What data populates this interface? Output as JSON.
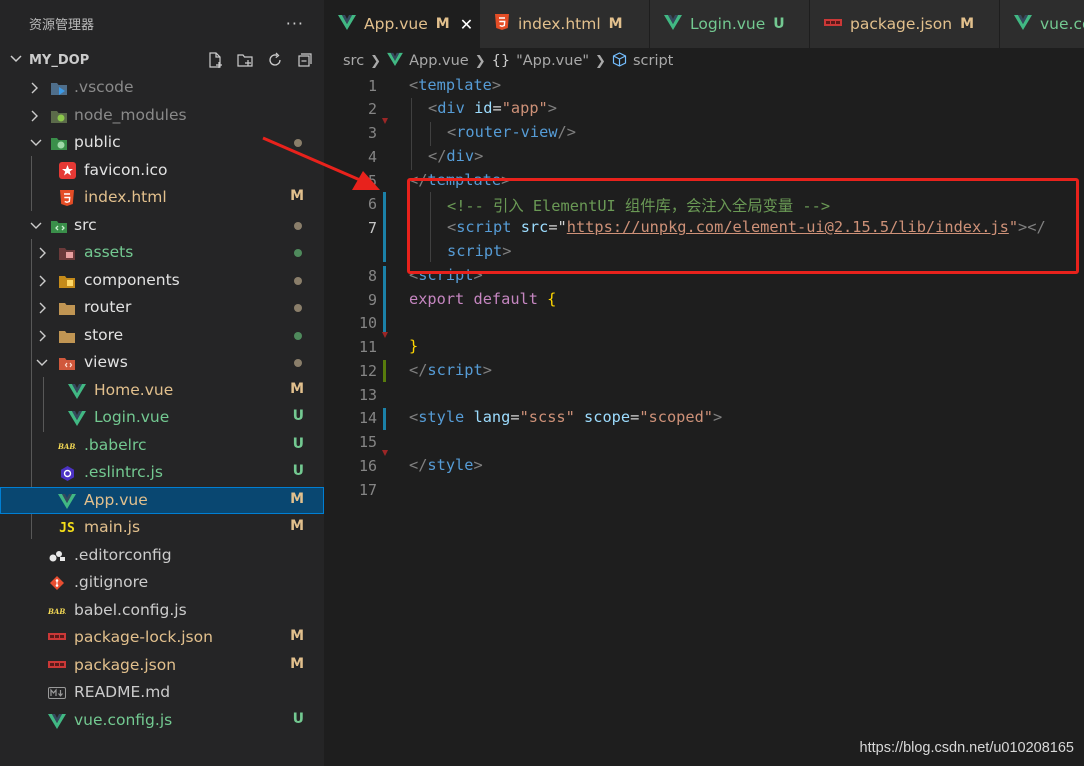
{
  "sidebar": {
    "title": "资源管理器",
    "more": "···",
    "root": "MY_DOP",
    "items": [
      {
        "name": ".vscode",
        "type": "folder",
        "icon": "vscode-folder-icon",
        "color": "#8a8a8a",
        "badge": ""
      },
      {
        "name": "node_modules",
        "type": "folder",
        "icon": "node-modules-folder-icon",
        "color": "#8a8a8a",
        "badge": ""
      },
      {
        "name": "public",
        "type": "folder",
        "icon": "public-folder-icon",
        "color": "#e2e2e2",
        "badge": "dot"
      },
      {
        "name": "favicon.ico",
        "type": "file",
        "icon": "favicon-icon",
        "color": "#e2e2e2",
        "badge": ""
      },
      {
        "name": "index.html",
        "type": "file",
        "icon": "html-file-icon",
        "color": "#e2c08d",
        "badge": "M"
      },
      {
        "name": "src",
        "type": "folder",
        "icon": "src-folder-icon",
        "color": "#e2e2e2",
        "badge": "dot"
      },
      {
        "name": "assets",
        "type": "folder",
        "icon": "assets-folder-icon",
        "color": "#73c991",
        "badge": "dot"
      },
      {
        "name": "components",
        "type": "folder",
        "icon": "components-folder-icon",
        "color": "#e2e2e2",
        "badge": "dot"
      },
      {
        "name": "router",
        "type": "folder",
        "icon": "folder-icon",
        "color": "#e2e2e2",
        "badge": "dot"
      },
      {
        "name": "store",
        "type": "folder",
        "icon": "folder-icon",
        "color": "#e2e2e2",
        "badge": "dot"
      },
      {
        "name": "views",
        "type": "folder",
        "icon": "views-folder-icon",
        "color": "#e2e2e2",
        "badge": "dot"
      },
      {
        "name": "Home.vue",
        "type": "file",
        "icon": "vue-file-icon",
        "color": "#e2c08d",
        "badge": "M"
      },
      {
        "name": "Login.vue",
        "type": "file",
        "icon": "vue-file-icon",
        "color": "#73c991",
        "badge": "U"
      },
      {
        "name": ".babelrc",
        "type": "file",
        "icon": "babel-file-icon",
        "color": "#73c991",
        "badge": "U"
      },
      {
        "name": ".eslintrc.js",
        "type": "file",
        "icon": "eslint-file-icon",
        "color": "#73c991",
        "badge": "U"
      },
      {
        "name": "App.vue",
        "type": "file",
        "icon": "vue-file-icon",
        "color": "#e2c08d",
        "badge": "M"
      },
      {
        "name": "main.js",
        "type": "file",
        "icon": "js-file-icon",
        "color": "#e2c08d",
        "badge": "M"
      },
      {
        "name": ".editorconfig",
        "type": "file",
        "icon": "editorconfig-file-icon",
        "color": "#cccccc",
        "badge": ""
      },
      {
        "name": ".gitignore",
        "type": "file",
        "icon": "git-file-icon",
        "color": "#cccccc",
        "badge": ""
      },
      {
        "name": "babel.config.js",
        "type": "file",
        "icon": "babel-file-icon",
        "color": "#cccccc",
        "badge": ""
      },
      {
        "name": "package-lock.json",
        "type": "file",
        "icon": "npm-file-icon",
        "color": "#e2c08d",
        "badge": "M"
      },
      {
        "name": "package.json",
        "type": "file",
        "icon": "npm-file-icon",
        "color": "#e2c08d",
        "badge": "M"
      },
      {
        "name": "README.md",
        "type": "file",
        "icon": "markdown-file-icon",
        "color": "#cccccc",
        "badge": ""
      },
      {
        "name": "vue.config.js",
        "type": "file",
        "icon": "vue-file-icon",
        "color": "#73c991",
        "badge": "U"
      }
    ]
  },
  "tabs": [
    {
      "label": "App.vue",
      "badge": "M",
      "icon": "vue-file-icon",
      "color": "#e2c08d",
      "close": "✕"
    },
    {
      "label": "index.html",
      "badge": "M",
      "icon": "html-file-icon",
      "color": "#e2c08d"
    },
    {
      "label": "Login.vue",
      "badge": "U",
      "icon": "vue-file-icon",
      "color": "#73c991"
    },
    {
      "label": "package.json",
      "badge": "M",
      "icon": "npm-file-icon",
      "color": "#e2c08d"
    },
    {
      "label": "vue.co",
      "badge": "",
      "icon": "vue-file-icon",
      "color": "#73c991"
    }
  ],
  "breadcrumb": {
    "folder": "src",
    "file": "App.vue",
    "symbol": "\"App.vue\"",
    "symbol_prefix": "{}",
    "section": "script"
  },
  "editor": {
    "line_numbers": [
      "1",
      "2",
      "3",
      "4",
      "5",
      "6",
      "7",
      "",
      "8",
      "9",
      "10",
      "11",
      "12",
      "13",
      "14",
      "15",
      "16",
      "17"
    ],
    "lines": {
      "l1": "template",
      "l2_tag": "div",
      "l2_attr": "id",
      "l2_val": "\"app\"",
      "l3": "router-view",
      "l4": "div",
      "l5": "template",
      "l6": "<!-- 引入 ElementUI 组件库，会注入全局变量 -->",
      "l7_tag": "script",
      "l7_attr": "src",
      "l7_url": "https://unpkg.com/element-ui@2.15.5/lib/index.js",
      "l7_wrap": "script",
      "l8": "script",
      "l9_kw1": "export",
      "l9_kw2": "default",
      "l9_brace": "{",
      "l11_brace": "}",
      "l12": "script",
      "l14_tag": "style",
      "l14_attr1": "lang",
      "l14_val1": "\"scss\"",
      "l14_attr2": "scope",
      "l14_val2": "\"scoped\"",
      "l16": "style"
    }
  },
  "watermark": "https://blog.csdn.net/u010208165",
  "colors": {
    "modified": "#e2c08d",
    "untracked": "#73c991",
    "annotation_red": "#e8221c",
    "selection": "#094771"
  }
}
